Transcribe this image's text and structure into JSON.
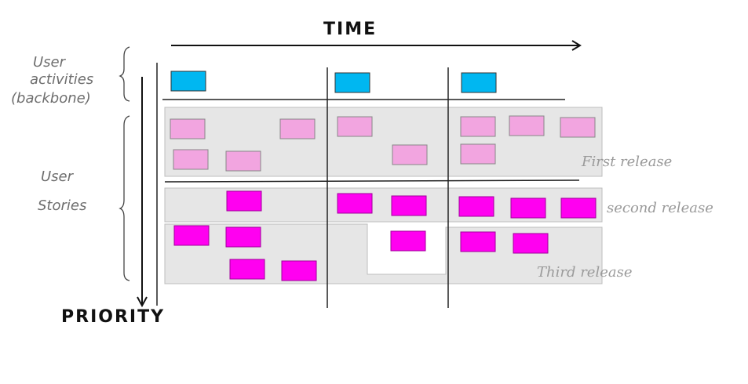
{
  "axes": {
    "time_label": "TIME",
    "priority_label": "PRIORITY"
  },
  "side_labels": {
    "backbone": [
      "User",
      "activities",
      "(backbone)"
    ],
    "stories": [
      "User",
      "Stories"
    ]
  },
  "releases": {
    "first": "First release",
    "second": "second release",
    "third": "Third release"
  },
  "colors": {
    "backbone_card": "#00b7f1",
    "first_release_card": "#f2a5e0",
    "later_release_card": "#ff00f0",
    "release_band": "#e6e6e6",
    "line": "#222222"
  }
}
